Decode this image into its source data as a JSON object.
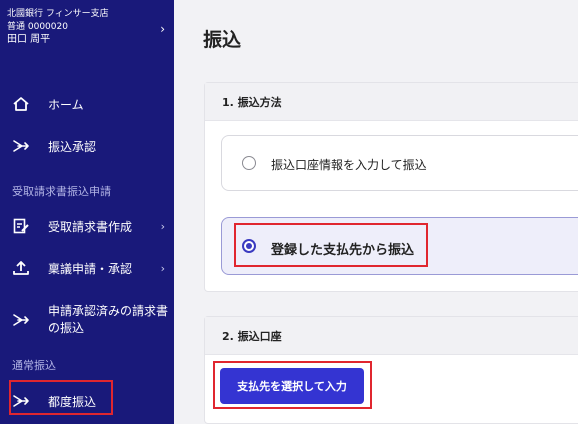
{
  "account": {
    "bank_branch": "北國銀行 フィンサー支店",
    "account_number": "普通 0000020",
    "holder_name": "田口 周平"
  },
  "sidebar": {
    "items": [
      {
        "label": "ホーム",
        "icon": "home-icon"
      },
      {
        "label": "振込承認",
        "icon": "transfer-icon"
      }
    ],
    "section_invoice": "受取請求書振込申請",
    "invoice_items": [
      {
        "label": "受取請求書作成",
        "icon": "document-edit-icon"
      },
      {
        "label": "稟議申請・承認",
        "icon": "upload-icon"
      },
      {
        "label_line1": "申請承認済みの請求書",
        "label_line2": "の振込",
        "icon": "transfer-icon"
      }
    ],
    "section_regular": "通常振込",
    "regular_items": [
      {
        "label": "都度振込",
        "icon": "transfer-icon"
      }
    ]
  },
  "main": {
    "title": "振込",
    "method_card": {
      "header": "1. 振込方法",
      "options": [
        {
          "label": "振込口座情報を入力して振込",
          "selected": false
        },
        {
          "label": "登録した支払先から振込",
          "selected": true
        }
      ]
    },
    "account_card": {
      "header": "2. 振込口座",
      "button_label": "支払先を選択して入力"
    }
  },
  "colors": {
    "sidebar_bg": "#19197a",
    "primary": "#3434d2",
    "highlight_box": "#e0262f"
  }
}
